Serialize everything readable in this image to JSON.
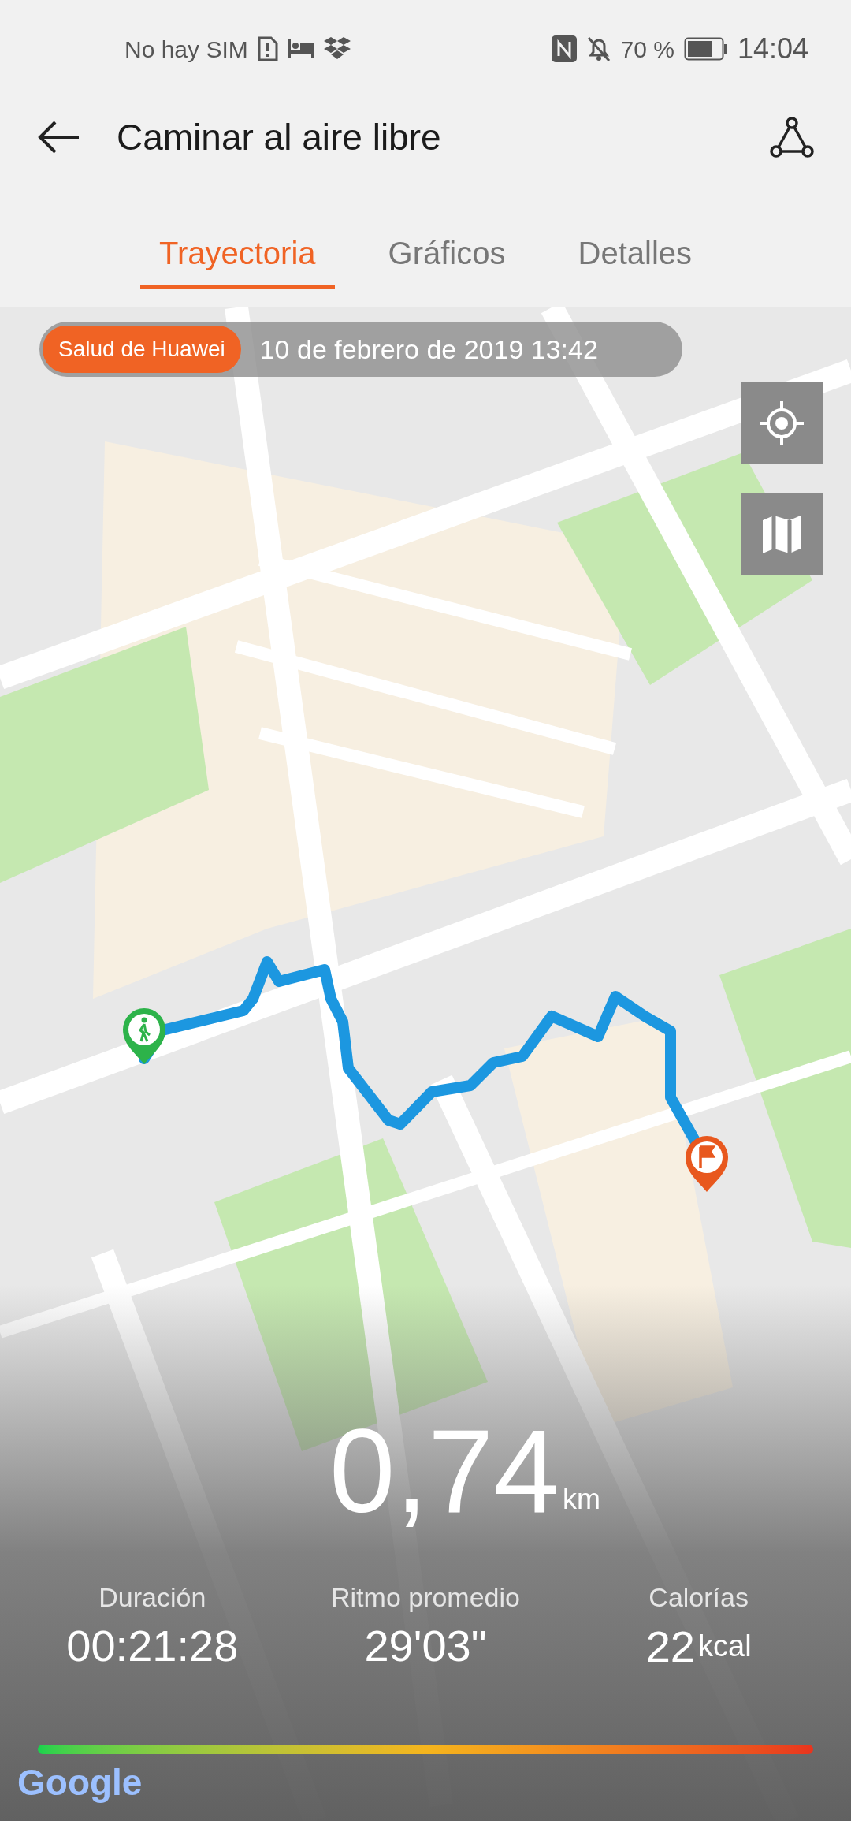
{
  "status_bar": {
    "carrier": "No hay SIM",
    "battery": "70 %",
    "time": "14:04"
  },
  "header": {
    "title": "Caminar al aire libre"
  },
  "tabs": [
    {
      "label": "Trayectoria",
      "selected": true
    },
    {
      "label": "Gráficos",
      "selected": false
    },
    {
      "label": "Detalles",
      "selected": false
    }
  ],
  "map": {
    "source_badge": "Salud de Huawei",
    "date": "10 de febrero de 2019 13:42",
    "attribution": "Google"
  },
  "summary": {
    "distance": "0,74",
    "distance_unit": "km",
    "stats": [
      {
        "label": "Duración",
        "value": "00:21:28"
      },
      {
        "label": "Ritmo promedio",
        "value": "29'03\""
      },
      {
        "label": "Calorías",
        "value": "22",
        "unit": "kcal"
      }
    ]
  }
}
